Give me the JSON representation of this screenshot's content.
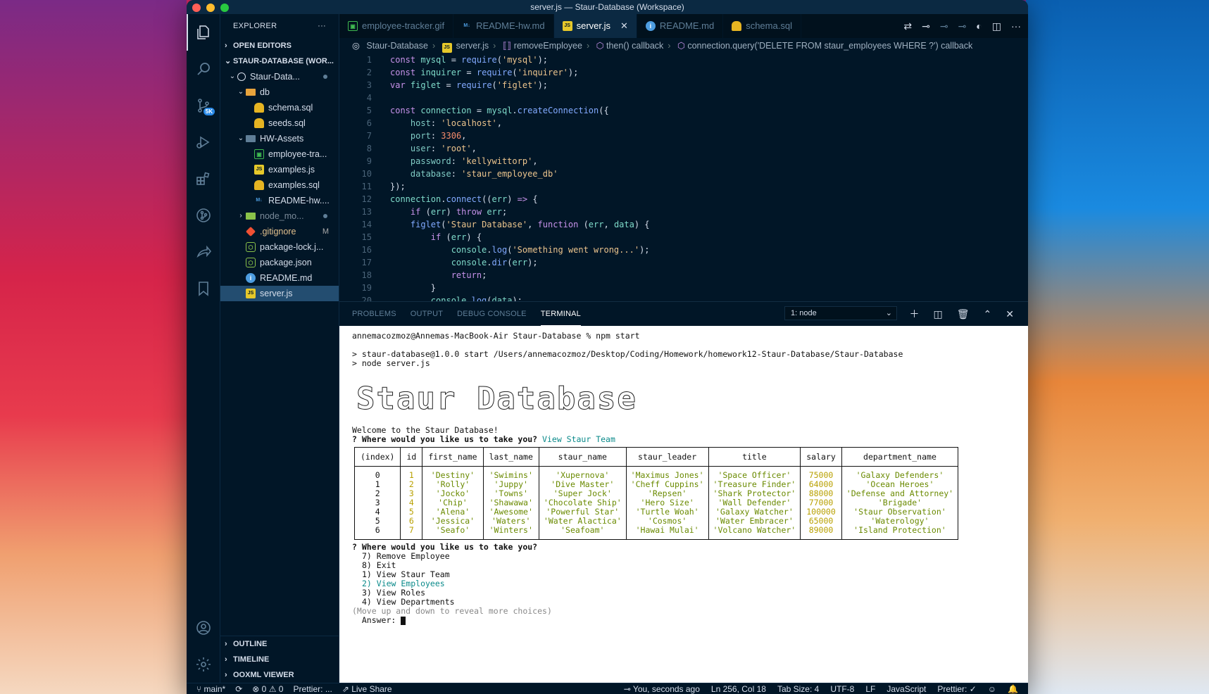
{
  "window": {
    "title": "server.js — Staur-Database (Workspace)"
  },
  "activity": {
    "scm_badge": "5K"
  },
  "sidebar": {
    "header": "EXPLORER",
    "more": "···",
    "open_editors": "OPEN EDITORS",
    "workspace": "STAUR-DATABASE (WOR...",
    "root": "Staur-Data...",
    "items": [
      {
        "label": "db",
        "kind": "folder"
      },
      {
        "label": "schema.sql",
        "kind": "sql"
      },
      {
        "label": "seeds.sql",
        "kind": "sql"
      },
      {
        "label": "HW-Assets",
        "kind": "folder"
      },
      {
        "label": "employee-tra...",
        "kind": "gif"
      },
      {
        "label": "examples.js",
        "kind": "js"
      },
      {
        "label": "examples.sql",
        "kind": "sql"
      },
      {
        "label": "README-hw....",
        "kind": "md"
      },
      {
        "label": "node_mo...",
        "kind": "folder"
      },
      {
        "label": ".gitignore",
        "kind": "git",
        "mark": "M"
      },
      {
        "label": "package-lock.j...",
        "kind": "json"
      },
      {
        "label": "package.json",
        "kind": "json"
      },
      {
        "label": "README.md",
        "kind": "info"
      },
      {
        "label": "server.js",
        "kind": "js"
      }
    ],
    "outline": "OUTLINE",
    "timeline": "TIMELINE",
    "ooxml": "OOXML VIEWER"
  },
  "tabs": [
    {
      "label": "employee-tracker.gif"
    },
    {
      "label": "README-hw.md"
    },
    {
      "label": "server.js"
    },
    {
      "label": "README.md"
    },
    {
      "label": "schema.sql"
    }
  ],
  "breadcrumb": [
    "Staur-Database",
    "server.js",
    "removeEmployee",
    "then() callback",
    "connection.query('DELETE FROM staur_employees WHERE ?') callback"
  ],
  "panel": {
    "tabs": [
      "PROBLEMS",
      "OUTPUT",
      "DEBUG CONSOLE",
      "TERMINAL"
    ],
    "terminal_select": "1: node"
  },
  "terminal": {
    "prompt": "annemacozmoz@Annemas-MacBook-Air Staur-Database % npm start",
    "npm1": "> staur-database@1.0.0 start /Users/annemacozmoz/Desktop/Coding/Homework/homework12-Staur-Database/Staur-Database",
    "npm2": "> node server.js",
    "banner": "Staur Database",
    "welcome": "Welcome to the Staur Database!",
    "q1": "? Where would you like us to take you?",
    "a1": "View Staur Team",
    "columns": [
      "(index)",
      "id",
      "first_name",
      "last_name",
      "staur_name",
      "staur_leader",
      "title",
      "salary",
      "department_name"
    ],
    "rows": [
      [
        "0",
        "1",
        "'Destiny'",
        "'Swimins'",
        "'Xupernova'",
        "'Maximus Jones'",
        "'Space Officer'",
        "75000",
        "'Galaxy Defenders'"
      ],
      [
        "1",
        "2",
        "'Rolly'",
        "'Juppy'",
        "'Dive Master'",
        "'Cheff Cuppins'",
        "'Treasure Finder'",
        "64000",
        "'Ocean Heroes'"
      ],
      [
        "2",
        "3",
        "'Jocko'",
        "'Towns'",
        "'Super Jock'",
        "'Repsen'",
        "'Shark Protector'",
        "88000",
        "'Defense and Attorney'"
      ],
      [
        "3",
        "4",
        "'Chip'",
        "'Shawawa'",
        "'Chocolate Ship'",
        "'Hero Size'",
        "'Wall Defender'",
        "77000",
        "'Brigade'"
      ],
      [
        "4",
        "5",
        "'Alena'",
        "'Awesome'",
        "'Powerful Star'",
        "'Turtle Woah'",
        "'Galaxy Watcher'",
        "100000",
        "'Staur Observation'"
      ],
      [
        "5",
        "6",
        "'Jessica'",
        "'Waters'",
        "'Water Alactica'",
        "'Cosmos'",
        "'Water Embracer'",
        "65000",
        "'Waterology'"
      ],
      [
        "6",
        "7",
        "'Seafo'",
        "'Winters'",
        "'Seafoam'",
        "'Hawai Mulai'",
        "'Volcano Watcher'",
        "89000",
        "'Island Protection'"
      ]
    ],
    "q2": "? Where would you like us to take you?",
    "choices": [
      "7) Remove Employee",
      "8) Exit",
      "1) View Staur Team",
      "2) View Employees",
      "3) View Roles",
      "4) View Departments"
    ],
    "selected_choice": "2) View Employees",
    "hint": "(Move up and down to reveal more choices)",
    "answer": "Answer:"
  },
  "status": {
    "branch": "main*",
    "errors": "⊗ 0 ⚠ 0",
    "prettier_left": "Prettier: ...",
    "liveshare": "Live Share",
    "blame": "You, seconds ago",
    "position": "Ln 256, Col 18",
    "tab_size": "Tab Size: 4",
    "encoding": "UTF-8",
    "eol": "LF",
    "language": "JavaScript",
    "prettier": "Prettier: ✓"
  },
  "colors": {
    "accent": "#011627",
    "selection": "#234d70",
    "terminal_bg": "#ffffff"
  }
}
